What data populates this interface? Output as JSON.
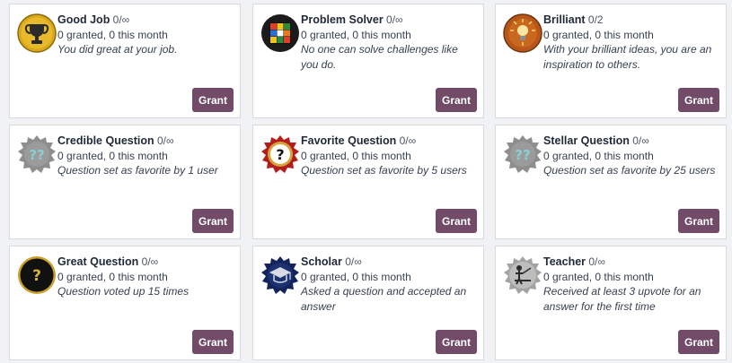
{
  "grant_label": "Grant",
  "badges": [
    {
      "title": "Good Job",
      "count": "0/∞",
      "stats": "0 granted, 0 this month",
      "description": "You did great at your job.",
      "icon": "trophy-icon"
    },
    {
      "title": "Problem Solver",
      "count": "0/∞",
      "stats": "0 granted, 0 this month",
      "description": "No one can solve challenges like you do.",
      "icon": "rubiks-cube-icon"
    },
    {
      "title": "Brilliant",
      "count": "0/2",
      "stats": "0 granted, 0 this month",
      "description": "With your brilliant ideas, you are an inspiration to others.",
      "icon": "lightbulb-icon"
    },
    {
      "title": "Credible Question",
      "count": "0/∞",
      "stats": "0 granted, 0 this month",
      "description": "Question set as favorite by 1 user",
      "icon": "question-marks-icon"
    },
    {
      "title": "Favorite Question",
      "count": "0/∞",
      "stats": "0 granted, 0 this month",
      "description": "Question set as favorite by 5 users",
      "icon": "question-mark-icon"
    },
    {
      "title": "Stellar Question",
      "count": "0/∞",
      "stats": "0 granted, 0 this month",
      "description": "Question set as favorite by 25 users",
      "icon": "question-marks-icon"
    },
    {
      "title": "Great Question",
      "count": "0/∞",
      "stats": "0 granted, 0 this month",
      "description": "Question voted up 15 times",
      "icon": "question-mark-icon"
    },
    {
      "title": "Scholar",
      "count": "0/∞",
      "stats": "0 granted, 0 this month",
      "description": "Asked a question and accepted an answer",
      "icon": "graduation-cap-icon"
    },
    {
      "title": "Teacher",
      "count": "0/∞",
      "stats": "0 granted, 0 this month",
      "description": "Received at least 3 upvote for an answer for the first time",
      "icon": "teacher-icon"
    }
  ]
}
